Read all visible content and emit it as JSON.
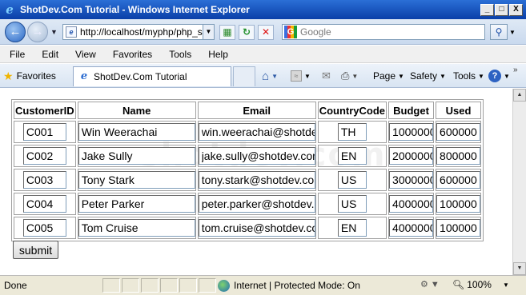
{
  "window": {
    "title": "ShotDev.Com Tutorial - Windows Internet Explorer",
    "controls": [
      "_",
      "□",
      "X"
    ]
  },
  "nav": {
    "url": "http://localhost/myphp/php_sc",
    "search_placeholder": "Google"
  },
  "menu": [
    "File",
    "Edit",
    "View",
    "Favorites",
    "Tools",
    "Help"
  ],
  "favbar": {
    "favorites_label": "Favorites",
    "tab_title": "ShotDev.Com Tutorial",
    "commands": {
      "page": "Page",
      "safety": "Safety",
      "tools": "Tools"
    }
  },
  "content": {
    "watermark": "shotdev.com",
    "table": {
      "headers": [
        "CustomerID",
        "Name",
        "Email",
        "CountryCode",
        "Budget",
        "Used"
      ],
      "rows": [
        [
          "C001",
          "Win Weerachai",
          "win.weerachai@shotdev.com",
          "TH",
          "1000000",
          "600000"
        ],
        [
          "C002",
          "Jake Sully",
          "jake.sully@shotdev.com",
          "EN",
          "2000000",
          "800000"
        ],
        [
          "C003",
          "Tony Stark",
          "tony.stark@shotdev.com",
          "US",
          "3000000",
          "600000"
        ],
        [
          "C004",
          "Peter Parker",
          "peter.parker@shotdev.com",
          "US",
          "4000000",
          "100000"
        ],
        [
          "C005",
          "Tom Cruise",
          "tom.cruise@shotdev.com",
          "EN",
          "4000000",
          "100000"
        ]
      ]
    },
    "submit_label": "submit"
  },
  "status": {
    "text": "Done",
    "zone": "Internet | Protected Mode: On",
    "zoom": "100%"
  }
}
